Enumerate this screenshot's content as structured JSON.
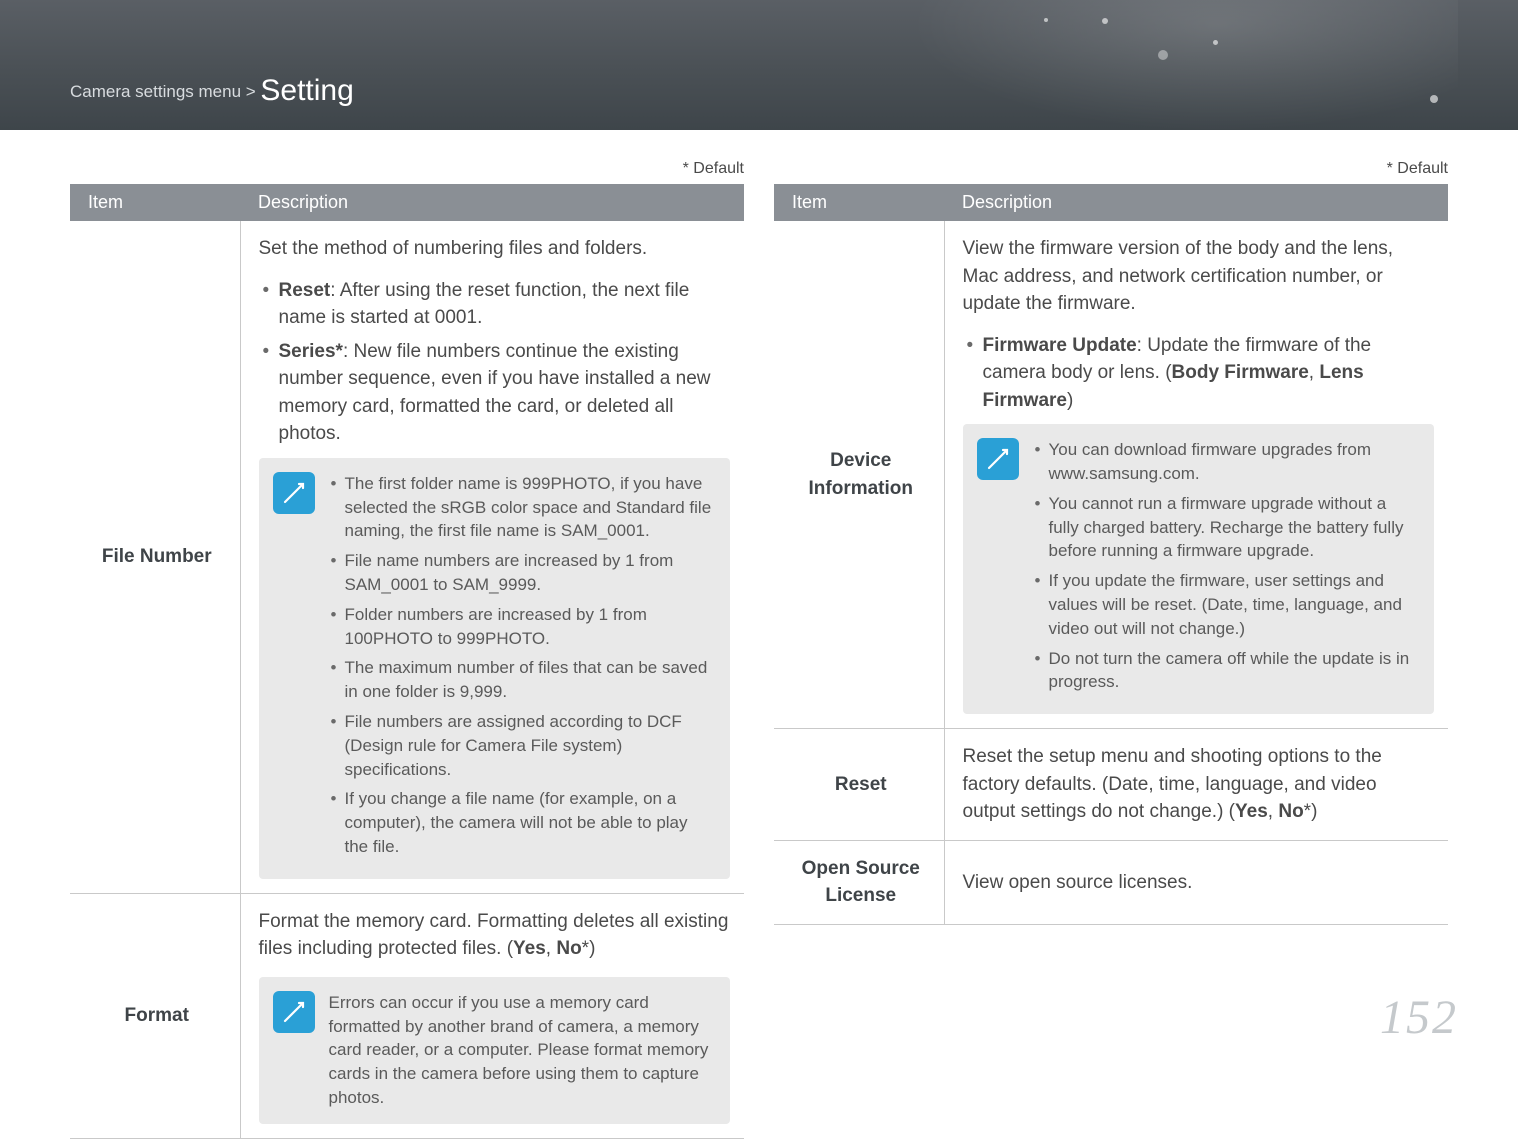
{
  "breadcrumb": {
    "prefix": "Camera settings menu > ",
    "title": "Setting"
  },
  "default_note": "* Default",
  "headers": {
    "item": "Item",
    "description": "Description"
  },
  "page_number": "152",
  "left": {
    "file_number": {
      "label": "File Number",
      "intro": "Set the method of numbering files and folders.",
      "bullets": [
        {
          "bold": "Reset",
          "rest": ": After using the reset function, the next file name is started at 0001."
        },
        {
          "bold": "Series*",
          "rest": ": New file numbers continue the existing number sequence, even if you have installed a new memory card, formatted the card, or deleted all photos."
        }
      ],
      "notes": [
        "The first folder name is 999PHOTO, if you have selected the sRGB color space and Standard file naming, the first file name is SAM_0001.",
        "File name numbers are increased by 1 from SAM_0001 to SAM_9999.",
        "Folder numbers are increased by 1 from 100PHOTO to 999PHOTO.",
        "The maximum number of files that can be saved in one folder is 9,999.",
        "File numbers are assigned according to DCF (Design rule for Camera File system) specifications.",
        "If you change a file name (for example, on a computer), the camera will not be able to play the file."
      ]
    },
    "format": {
      "label": "Format",
      "intro_a": "Format the memory card. Formatting deletes all existing files including protected files. (",
      "intro_yes": "Yes",
      "intro_sep": ", ",
      "intro_no": "No",
      "intro_b": "*)",
      "note": "Errors can occur if you use a memory card formatted by another brand of camera, a memory card reader, or a computer. Please format memory cards in the camera before using them to capture photos."
    }
  },
  "right": {
    "device_info": {
      "label": "Device Information",
      "intro": "View the firmware version of the body and the lens, Mac address, and network certification number, or update the firmware.",
      "bullet_bold": "Firmware Update",
      "bullet_rest_a": ": Update the firmware of the camera body or lens. (",
      "bullet_bf": "Body Firmware",
      "bullet_sep": ", ",
      "bullet_lf": "Lens Firmware",
      "bullet_rest_b": ")",
      "notes": [
        "You can download firmware upgrades from www.samsung.com.",
        "You cannot run a firmware upgrade without a fully charged battery. Recharge the battery fully before running a firmware upgrade.",
        "If you update the firmware, user settings and values will be reset. (Date, time, language, and video out will not change.)",
        "Do not turn the camera off while the update is in progress."
      ]
    },
    "reset": {
      "label": "Reset",
      "text_a": "Reset the setup menu and shooting options to the factory defaults. (Date, time, language, and video output settings do not change.) (",
      "yes": "Yes",
      "sep": ", ",
      "no": "No",
      "text_b": "*)"
    },
    "open_source": {
      "label": "Open Source License",
      "text": "View open source licenses."
    }
  }
}
